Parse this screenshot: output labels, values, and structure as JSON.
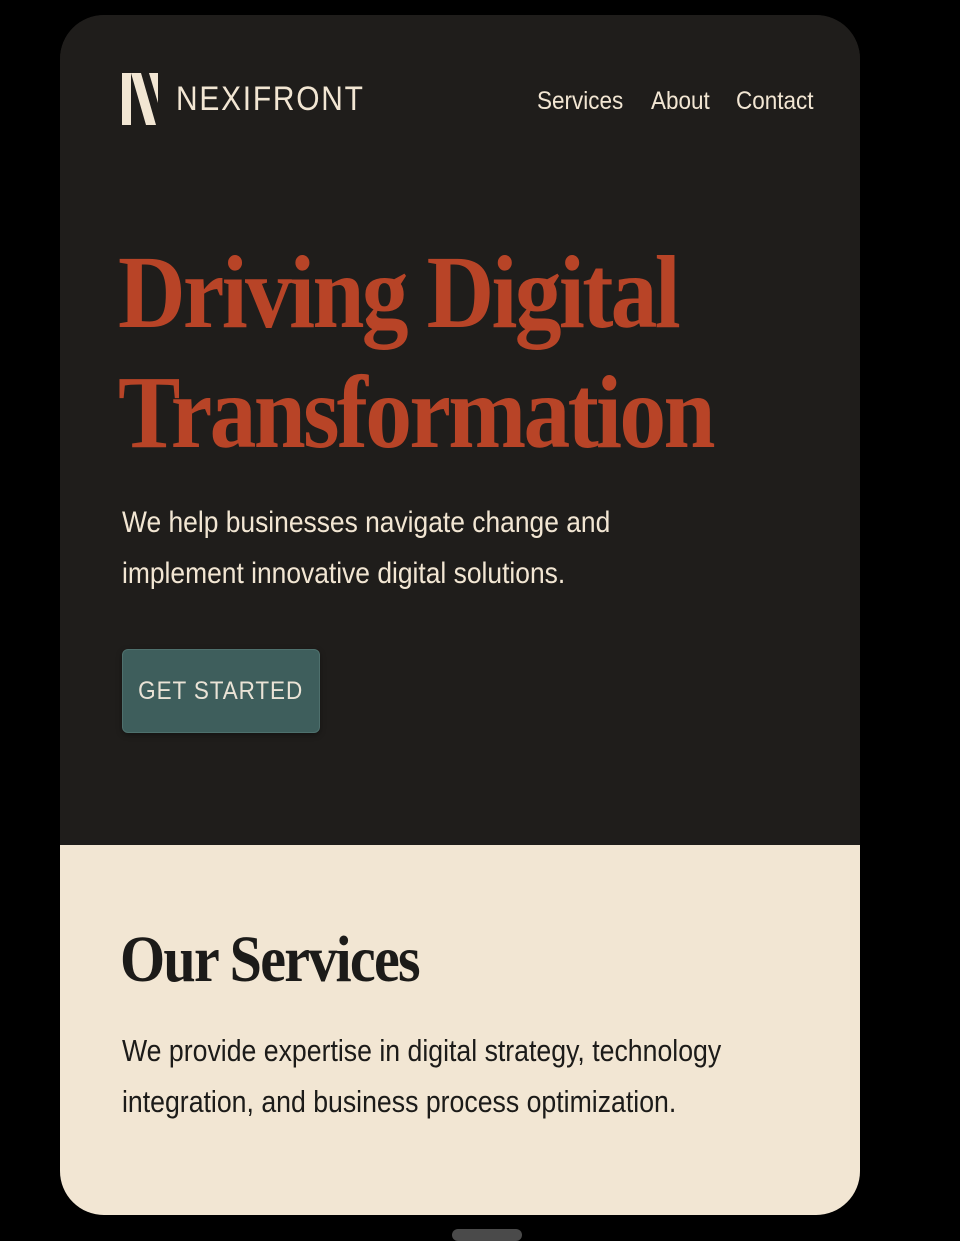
{
  "brand": {
    "name": "NEXIFRONT",
    "logo_icon": "nexifront-n-icon"
  },
  "nav": {
    "items": [
      {
        "label": "Services"
      },
      {
        "label": "About"
      },
      {
        "label": "Contact"
      }
    ]
  },
  "hero": {
    "headline_line1": "Driving Digital",
    "headline_line2": "Transformation",
    "subtext_line1": "We help businesses navigate change and",
    "subtext_line2": "implement innovative digital solutions.",
    "cta_label": "GET STARTED"
  },
  "services": {
    "title": "Our Services",
    "text_line1": "We provide expertise in digital strategy, technology",
    "text_line2": "integration, and business process optimization."
  },
  "colors": {
    "hero_background": "#1f1d1b",
    "headline": "#b84427",
    "light_text": "#f2e6d3",
    "cta_background": "#3e5e5c",
    "services_background": "#f2e6d3",
    "dark_text": "#1c1b19"
  }
}
